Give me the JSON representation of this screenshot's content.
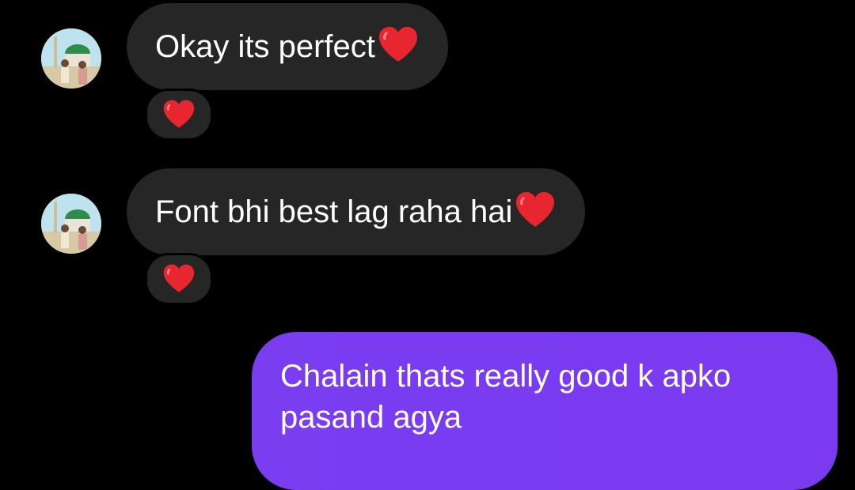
{
  "conversation": {
    "messages": [
      {
        "sender": "other",
        "text": "Okay its perfect",
        "emoji": "red-heart",
        "reaction": "red-heart"
      },
      {
        "sender": "other",
        "text": "Font bhi best lag raha hai",
        "emoji": "red-heart",
        "reaction": "red-heart"
      },
      {
        "sender": "self",
        "text": "Chalain thats really good k apko pasand agya"
      }
    ]
  },
  "colors": {
    "background": "#000000",
    "incoming_bubble": "#262626",
    "outgoing_bubble": "#7b3af0",
    "text": "#ffffff",
    "heart": "#e8262f"
  },
  "icons": {
    "heart": "red-heart-icon",
    "avatar": "contact-avatar"
  }
}
